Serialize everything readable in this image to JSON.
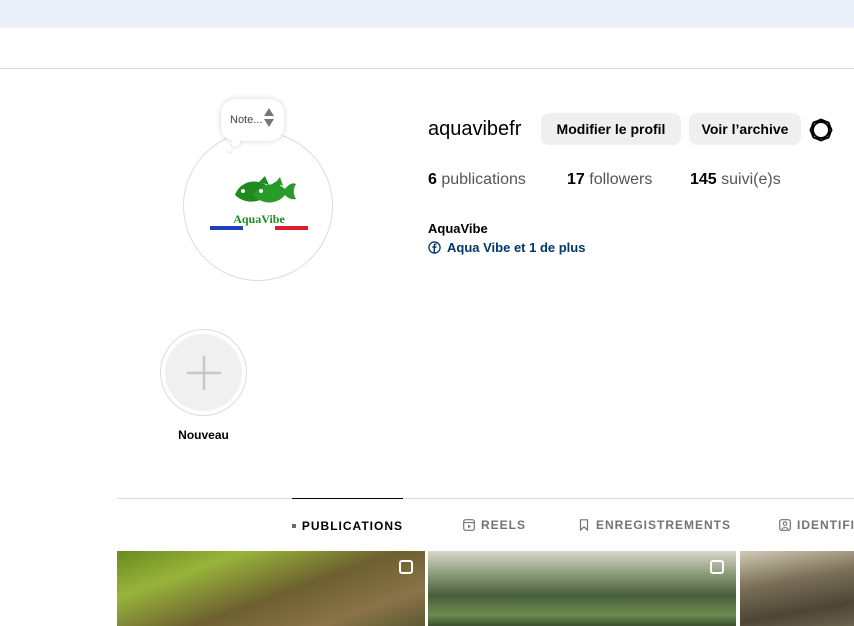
{
  "note": {
    "text": "Note..."
  },
  "profile": {
    "username": "aquavibefr",
    "edit_label": "Modifier le profil",
    "archive_label": "Voir l’archive",
    "fullname": "AquaVibe",
    "links_label": "Aqua Vibe et 1 de plus"
  },
  "stats": {
    "posts_count": "6",
    "posts_label": "publications",
    "followers_count": "17",
    "followers_label": "followers",
    "following_count": "145",
    "following_label": "suivi(e)s"
  },
  "avatar": {
    "logo_text": "AquaVibe"
  },
  "highlights": {
    "new_label": "Nouveau"
  },
  "tabs": [
    {
      "label": "PUBLICATIONS",
      "icon": "grid-icon",
      "active": true
    },
    {
      "label": "REELS",
      "icon": "reels-icon",
      "active": false
    },
    {
      "label": "ENREGISTREMENTS",
      "icon": "bookmark-icon",
      "active": false
    },
    {
      "label": "IDENTIFI",
      "icon": "tagged-icon",
      "active": false
    }
  ],
  "colors": {
    "link": "#00376b",
    "button_bg": "#efefef",
    "top_bar": "#eaf0f8",
    "logo_green": "#1f8a1f",
    "flag_blue": "#1f3fbf",
    "flag_red": "#d9202a"
  }
}
